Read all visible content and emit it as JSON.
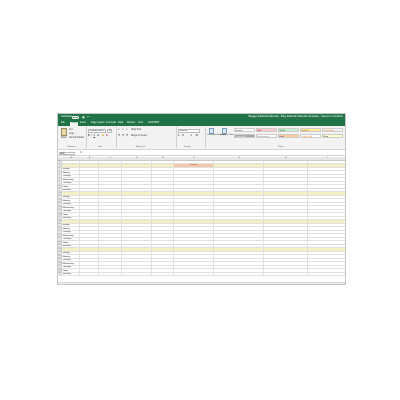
{
  "title_bar": {
    "autosave_label": "AutoSave",
    "toggle_label": "Off",
    "save_glyph": "▣",
    "undo_glyph": "↶",
    "document_title": "Blogger Editorial Calendar - Blog Editorial Calendar Template - Saved to OneDrive"
  },
  "tabs": [
    "File",
    "Home",
    "Insert",
    "Page Layout",
    "Formulas",
    "Data",
    "Review",
    "View",
    "ACROBAT"
  ],
  "active_tab": "Home",
  "ribbon": {
    "paste_label": "Paste",
    "cut_label": "Cut",
    "copy_label": "Copy",
    "format_painter_label": "Format Painter",
    "font_name": "Century Gothic",
    "font_size": "10",
    "wrap_text_label": "Wrap Text",
    "merge_label": "Merge & Center",
    "number_format": "General",
    "conditional_label": "Conditional Formatting",
    "format_table_label": "Format as Table",
    "groups": {
      "clipboard": "Clipboard",
      "font": "Font",
      "alignment": "Alignment",
      "number": "Number",
      "styles": "Styles"
    },
    "cell_styles": [
      {
        "label": "Normal",
        "bg": "#ffffff",
        "color": "#222222"
      },
      {
        "label": "Bad",
        "bg": "#ffc7ce",
        "color": "#9c0006"
      },
      {
        "label": "Good",
        "bg": "#c6efce",
        "color": "#006100"
      },
      {
        "label": "Neutral",
        "bg": "#ffeb9c",
        "color": "#9c5700"
      },
      {
        "label": "Calculation",
        "bg": "#f2f2f2",
        "color": "#fa7d00"
      },
      {
        "label": "Check Cell",
        "bg": "#a5a5a5",
        "color": "#ffffff"
      },
      {
        "label": "Explanatory...",
        "bg": "#ffffff",
        "color": "#7f7f7f"
      },
      {
        "label": "Input",
        "bg": "#ffcc99",
        "color": "#3f3f76"
      },
      {
        "label": "Linked Cell",
        "bg": "#ffffff",
        "color": "#fa7d00"
      },
      {
        "label": "Note",
        "bg": "#ffffcc",
        "color": "#222222"
      }
    ]
  },
  "formula_bar": {
    "name_box": "A18",
    "fx_label": "fx"
  },
  "columns": [
    "DAY",
    "DATE",
    "CATEGORY",
    "TOPIC",
    "AUTHOR",
    "BLOG TITLE",
    "DESCRIPTION",
    "KEYWORDS",
    "IMAGES"
  ],
  "rows": [
    {
      "num": "1",
      "type": "header"
    },
    {
      "num": "2",
      "type": "week",
      "cells": [
        "",
        "",
        "",
        "",
        "",
        "Bookmark",
        "",
        "",
        ""
      ]
    },
    {
      "num": "3",
      "type": "day",
      "cells": [
        "Sunday"
      ]
    },
    {
      "num": "4",
      "type": "day",
      "cells": [
        "Monday"
      ]
    },
    {
      "num": "5",
      "type": "day",
      "cells": [
        "Tuesday"
      ]
    },
    {
      "num": "6",
      "type": "day",
      "cells": [
        "Wednesday"
      ]
    },
    {
      "num": "7",
      "type": "day",
      "cells": [
        "Thursday"
      ]
    },
    {
      "num": "8",
      "type": "day",
      "cells": [
        "Friday"
      ]
    },
    {
      "num": "9",
      "type": "day",
      "cells": [
        "Saturday"
      ]
    },
    {
      "num": "10",
      "type": "week",
      "cells": []
    },
    {
      "num": "11",
      "type": "day",
      "cells": [
        "Sunday"
      ]
    },
    {
      "num": "12",
      "type": "day",
      "cells": [
        "Monday"
      ]
    },
    {
      "num": "13",
      "type": "day",
      "cells": [
        "Tuesday"
      ]
    },
    {
      "num": "14",
      "type": "day",
      "cells": [
        "Wednesday"
      ]
    },
    {
      "num": "15",
      "type": "day",
      "cells": [
        "Thursday"
      ]
    },
    {
      "num": "16",
      "type": "day",
      "cells": [
        "Friday"
      ]
    },
    {
      "num": "17",
      "type": "day",
      "cells": [
        "Saturday"
      ]
    },
    {
      "num": "18",
      "type": "week",
      "cells": []
    },
    {
      "num": "19",
      "type": "day",
      "cells": [
        "Sunday"
      ]
    },
    {
      "num": "20",
      "type": "day",
      "cells": [
        "Monday"
      ]
    },
    {
      "num": "21",
      "type": "day",
      "cells": [
        "Tuesday"
      ]
    },
    {
      "num": "22",
      "type": "day",
      "cells": [
        "Wednesday"
      ]
    },
    {
      "num": "23",
      "type": "day",
      "cells": [
        "Thursday"
      ]
    },
    {
      "num": "24",
      "type": "day",
      "cells": [
        "Friday"
      ]
    },
    {
      "num": "25",
      "type": "day",
      "cells": [
        "Saturday"
      ]
    },
    {
      "num": "26",
      "type": "week",
      "cells": []
    },
    {
      "num": "27",
      "type": "day",
      "cells": [
        "Sunday"
      ]
    },
    {
      "num": "28",
      "type": "day",
      "cells": [
        "Monday"
      ]
    },
    {
      "num": "29",
      "type": "day",
      "cells": [
        "Tuesday"
      ]
    },
    {
      "num": "30",
      "type": "day",
      "cells": [
        "Wednesday"
      ]
    },
    {
      "num": "31",
      "type": "day",
      "cells": [
        "Thursday"
      ]
    },
    {
      "num": "32",
      "type": "day",
      "cells": [
        "Friday"
      ]
    },
    {
      "num": "33",
      "type": "day",
      "cells": [
        "Saturday"
      ]
    }
  ],
  "colors": {
    "excel_green": "#217346",
    "week_band": "#f7efc4",
    "bookmark_cell": "#f5c6a8"
  }
}
